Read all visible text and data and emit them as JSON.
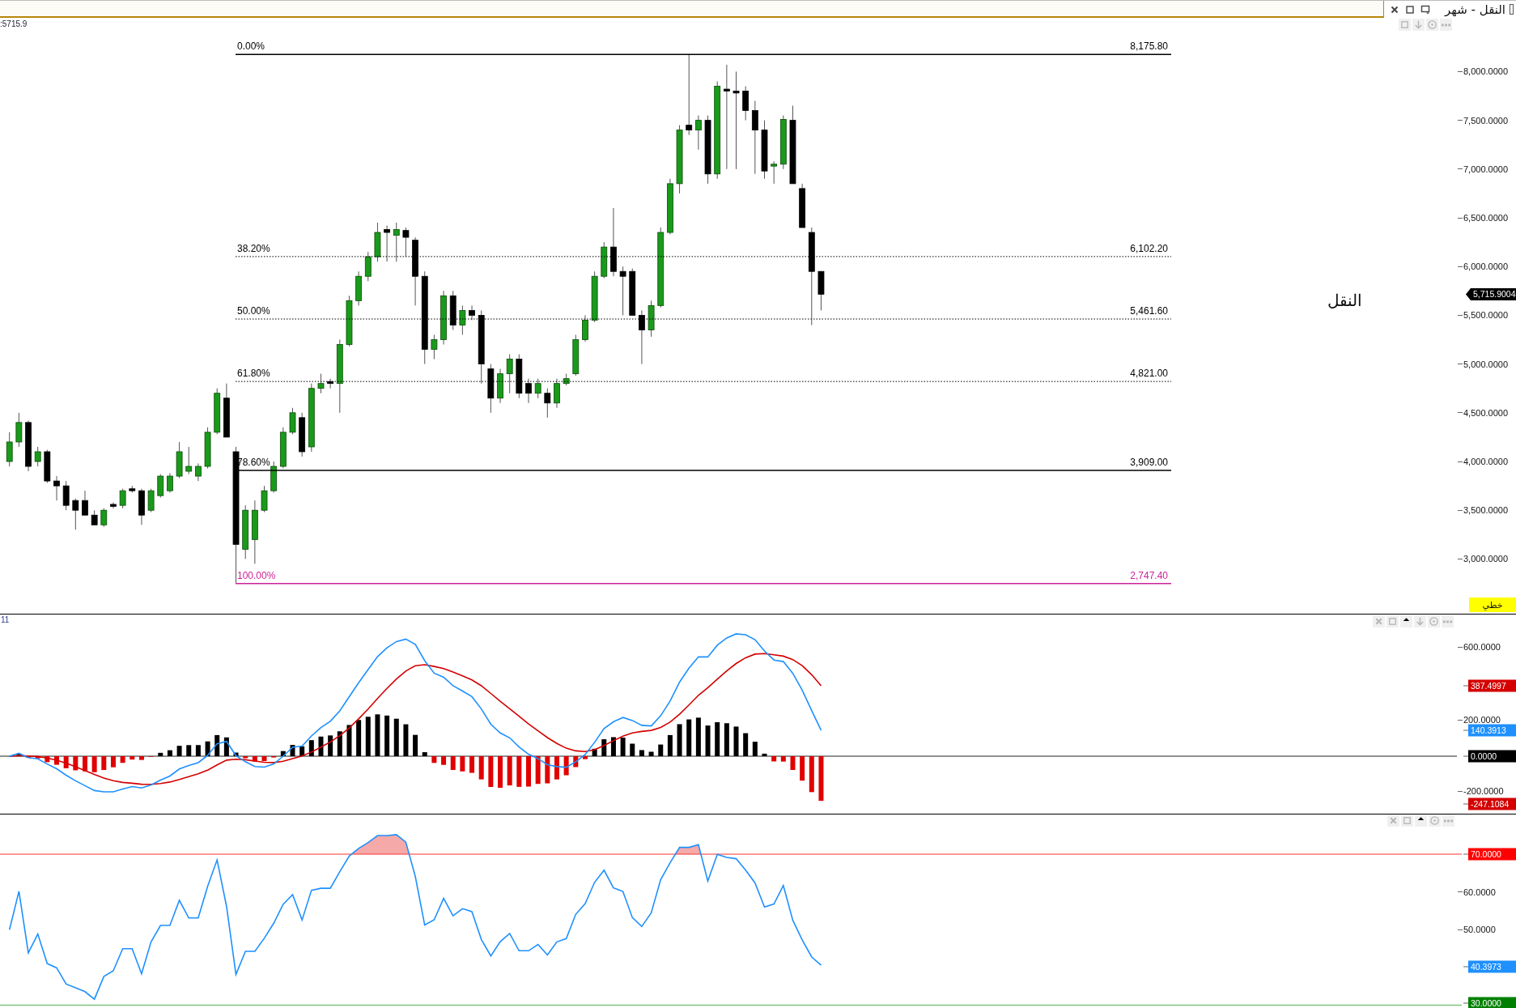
{
  "top_bar": {
    "title": "النقل - شهر"
  },
  "price_pane": {
    "readout": ":5715.9",
    "symbol_label": "النقل",
    "fib_levels": [
      {
        "percent": "0.00%",
        "value": "8,175.80",
        "kind": "solid",
        "color": "#000000"
      },
      {
        "percent": "38.20%",
        "value": "6,102.20",
        "kind": "dotted",
        "color": "#000000"
      },
      {
        "percent": "50.00%",
        "value": "5,461.60",
        "kind": "dotted",
        "color": "#000000"
      },
      {
        "percent": "61.80%",
        "value": "4,821.00",
        "kind": "dotted",
        "color": "#000000"
      },
      {
        "percent": "78.60%",
        "value": "3,909.00",
        "kind": "solid",
        "color": "#000000"
      },
      {
        "percent": "100.00%",
        "value": "2,747.40",
        "kind": "solid",
        "color": "#cc2299"
      }
    ],
    "axis_ticks": [
      "8,000.0000",
      "7,500.0000",
      "7,000.0000",
      "6,500.0000",
      "6,000.0000",
      "5,500.0000",
      "5,000.0000",
      "4,500.0000",
      "4,000.0000",
      "3,500.0000",
      "3,000.0000"
    ],
    "price_tag": "5,715.9004",
    "scale_button": "خطي"
  },
  "macd_pane": {
    "header": "11",
    "axis_labels": [
      {
        "text": "600.0000",
        "kind": "tick"
      },
      {
        "text": "387.4997",
        "kind": "tag",
        "color": "#d40000"
      },
      {
        "text": "200.0000",
        "kind": "tick"
      },
      {
        "text": "140.3913",
        "kind": "tag",
        "color": "#1e90ff"
      },
      {
        "text": "0.0000",
        "kind": "tag",
        "color": "#000000"
      },
      {
        "text": "-200.0000",
        "kind": "tick"
      },
      {
        "text": "-247.1084",
        "kind": "tag",
        "color": "#d40000"
      }
    ]
  },
  "rsi_pane": {
    "axis_labels": [
      {
        "text": "70.0000",
        "kind": "tag",
        "color": "#ff0000"
      },
      {
        "text": "60.0000",
        "kind": "tick"
      },
      {
        "text": "50.0000",
        "kind": "tick"
      },
      {
        "text": "40.3973",
        "kind": "tag",
        "color": "#1e90ff"
      },
      {
        "text": "30.0000",
        "kind": "tag",
        "color": "#008000"
      }
    ]
  }
}
